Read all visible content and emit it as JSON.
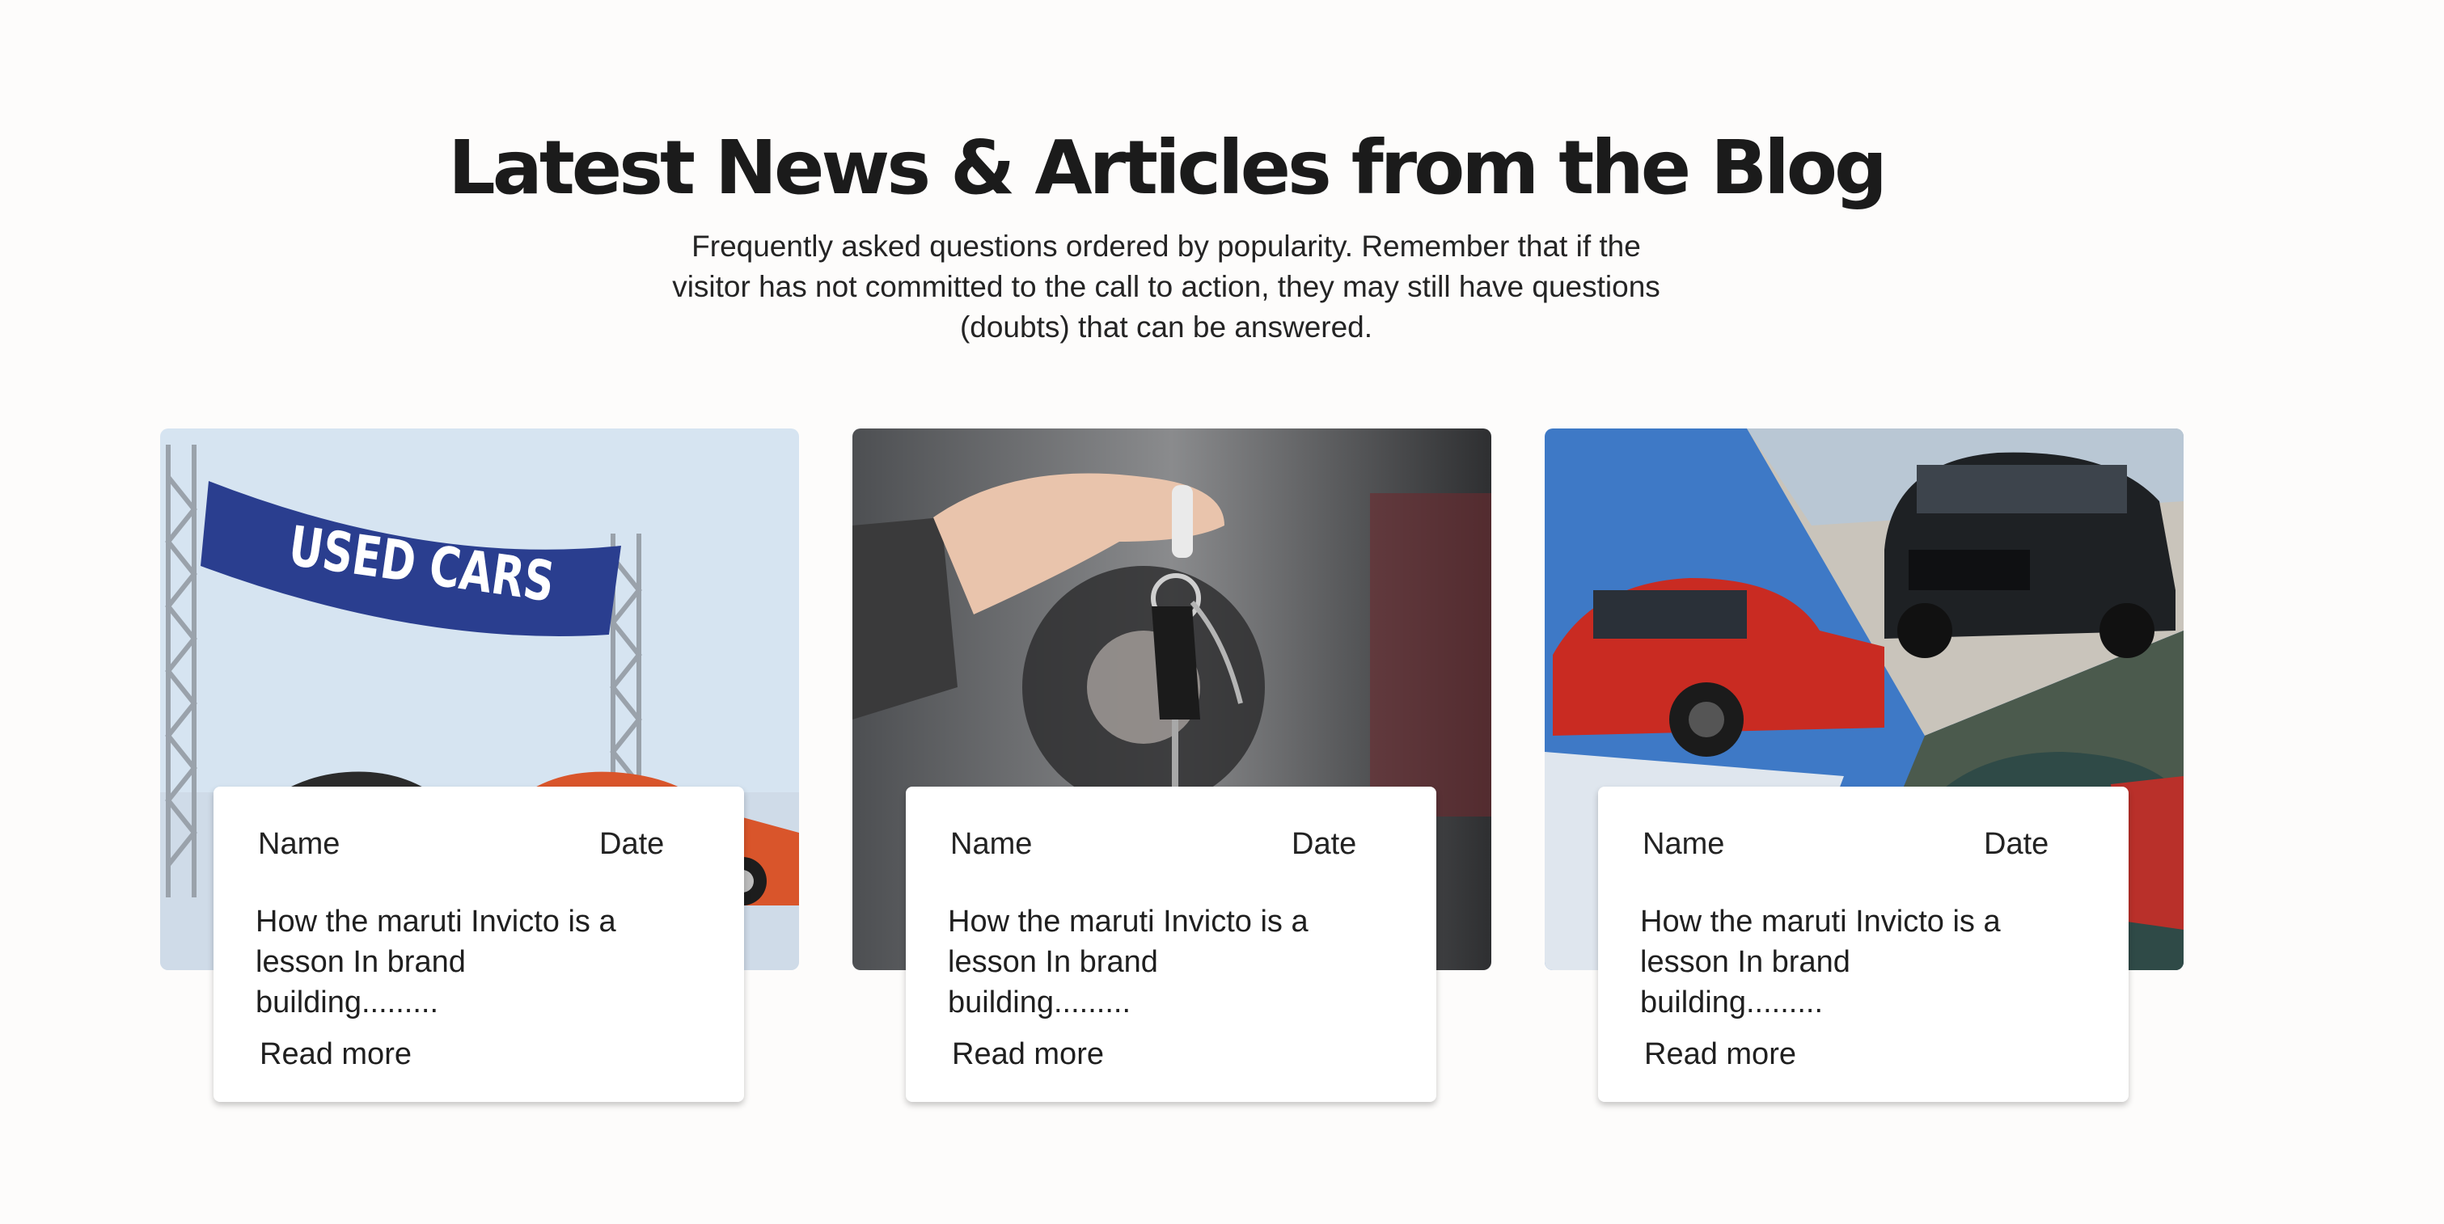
{
  "section": {
    "title": "Latest News & Articles from the Blog",
    "subtitle": "Frequently asked questions ordered by popularity. Remember that if the visitor has not committed to the call to action, they may still have questions (doubts) that can be answered."
  },
  "cards": [
    {
      "name": "Name",
      "date": "Date",
      "excerpt": "How the maruti Invicto is a lesson In brand building.........",
      "cta": "Read more",
      "image_banner_text": "USED CARS"
    },
    {
      "name": "Name",
      "date": "Date",
      "excerpt": "How the maruti Invicto is a lesson In brand building.........",
      "cta": "Read more"
    },
    {
      "name": "Name",
      "date": "Date",
      "excerpt": "How the maruti Invicto is a lesson In brand building.........",
      "cta": "Read more"
    }
  ],
  "colors": {
    "background": "#fdfcfb",
    "banner_blue": "#2a3e8f",
    "car_red": "#c92b22",
    "car_black": "#1e2124"
  }
}
